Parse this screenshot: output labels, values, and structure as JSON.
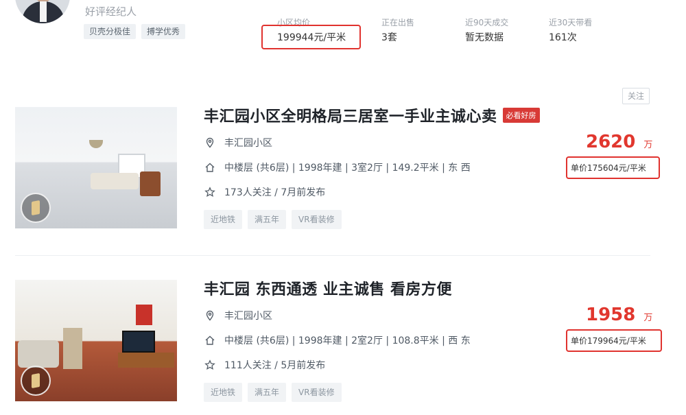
{
  "agent": {
    "role": "好评经纪人",
    "tags": [
      "贝壳分极佳",
      "搏学优秀"
    ]
  },
  "stats": [
    {
      "label": "小区均价",
      "value": "199944元/平米"
    },
    {
      "label": "正在出售",
      "value": "3套"
    },
    {
      "label": "近90天成交",
      "value": "暂无数据"
    },
    {
      "label": "近30天带看",
      "value": "161次"
    }
  ],
  "listings": [
    {
      "title": "丰汇园小区全明格局三居室一手业主诚心卖",
      "badge": "必看好房",
      "community": "丰汇园小区",
      "details": "中楼层 (共6层) | 1998年建 | 3室2厅 | 149.2平米 | 东 西",
      "meta": "173人关注 / 7月前发布",
      "chips": [
        "近地铁",
        "满五年",
        "VR看装修"
      ],
      "follow_label": "关注",
      "total_price": "2620",
      "price_unit": "万",
      "unit_price": "单价175604元/平米"
    },
    {
      "title": "丰汇园 东西通透 业主诚售 看房方便",
      "badge": "",
      "community": "丰汇园小区",
      "details": "中楼层 (共6层) | 1998年建 | 2室2厅 | 108.8平米 | 西 东",
      "meta": "111人关注 / 5月前发布",
      "chips": [
        "近地铁",
        "满五年",
        "VR看装修"
      ],
      "follow_label": "",
      "total_price": "1958",
      "price_unit": "万",
      "unit_price": "单价179964元/平米"
    }
  ],
  "colors": {
    "price_red": "#e1372e",
    "highlight_box": "#e0322e",
    "badge_red": "#d83a36"
  },
  "icons": {
    "location": "location-pin-icon",
    "house": "house-icon",
    "star": "star-icon",
    "vr": "vr-panorama-icon"
  }
}
